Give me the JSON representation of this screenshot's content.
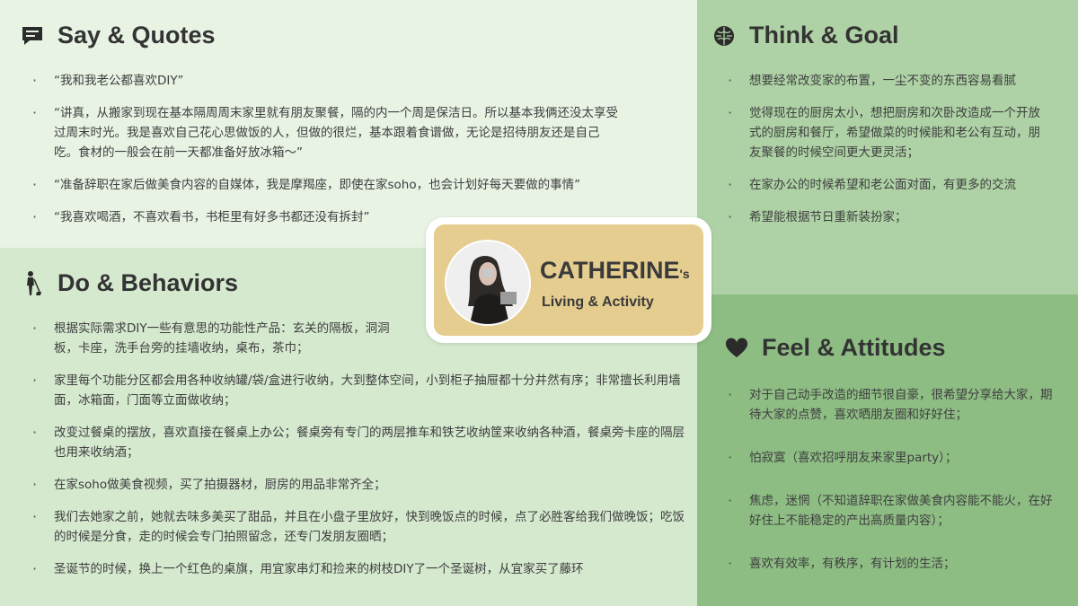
{
  "say": {
    "title": "Say & Quotes",
    "icon": "speech-bubble-icon",
    "items": [
      "“我和我老公都喜欢DIY”",
      "“讲真，从搬家到现在基本隔周周末家里就有朋友聚餐，隔的内一个周是保洁日。所以基本我俩还没太享受过周末时光。我是喜欢自己花心思做饭的人，但做的很烂，基本跟着食谱做，无论是招待朋友还是自己吃。食材的一般会在前一天都准备好放冰箱～”",
      "“准备辞职在家后做美食内容的自媒体，我是摩羯座，即使在家soho，也会计划好每天要做的事情”",
      "“我喜欢喝酒，不喜欢看书，书柜里有好多书都还没有拆封”"
    ]
  },
  "do": {
    "title": "Do & Behaviors",
    "icon": "person-cleaning-icon",
    "items": [
      "根据实际需求DIY一些有意思的功能性产品：玄关的隔板，洞洞板，卡座，洗手台旁的挂墙收纳，桌布，茶巾；",
      "家里每个功能分区都会用各种收纳罐/袋/盒进行收纳，大到整体空间，小到柜子抽屉都十分井然有序；非常擅长利用墙面，冰箱面，门面等立面做收纳；",
      "改变过餐桌的摆放，喜欢直接在餐桌上办公；餐桌旁有专门的两层推车和铁艺收纳筐来收纳各种酒，餐桌旁卡座的隔层也用来收纳酒；",
      "在家soho做美食视频，买了拍摄器材，厨房的用品非常齐全；",
      "我们去她家之前，她就去味多美买了甜品，并且在小盘子里放好，快到晚饭点的时候，点了必胜客给我们做晚饭；吃饭的时候是分食，走的时候会专门拍照留念，还专门发朋友圈晒；",
      "圣诞节的时候，换上一个红色的桌旗，用宜家串灯和捡来的树枝DIY了一个圣诞树，从宜家买了藤环"
    ]
  },
  "think": {
    "title": "Think & Goal",
    "icon": "brain-icon",
    "items": [
      "想要经常改变家的布置，一尘不变的东西容易看腻",
      "觉得现在的厨房太小，想把厨房和次卧改造成一个开放式的厨房和餐厅，希望做菜的时候能和老公有互动，朋友聚餐的时候空间更大更灵活；",
      "在家办公的时候希望和老公面对面，有更多的交流",
      "希望能根据节日重新装扮家；"
    ]
  },
  "feel": {
    "title": "Feel & Attitudes",
    "icon": "heart-icon",
    "items": [
      "对于自己动手改造的细节很自豪，很希望分享给大家，期待大家的点赞，喜欢晒朋友圈和好好住；",
      "怕寂寞（喜欢招呼朋友来家里party）；",
      "焦虑，迷惘（不知道辞职在家做美食内容能不能火，在好好住上不能稳定的产出高质量内容）；",
      "喜欢有效率，有秩序，有计划的生活；"
    ]
  },
  "persona": {
    "name": "CATHERINE",
    "suffix": "'s",
    "subtitle": "Living & Activity",
    "avatar": "persona-photo"
  },
  "colors": {
    "say_bg": "#e8f3e4",
    "do_bg": "#d5e9cf",
    "think_bg": "#aed2a5",
    "feel_bg": "#8ebd84",
    "card_bg": "#e5cd8f"
  }
}
